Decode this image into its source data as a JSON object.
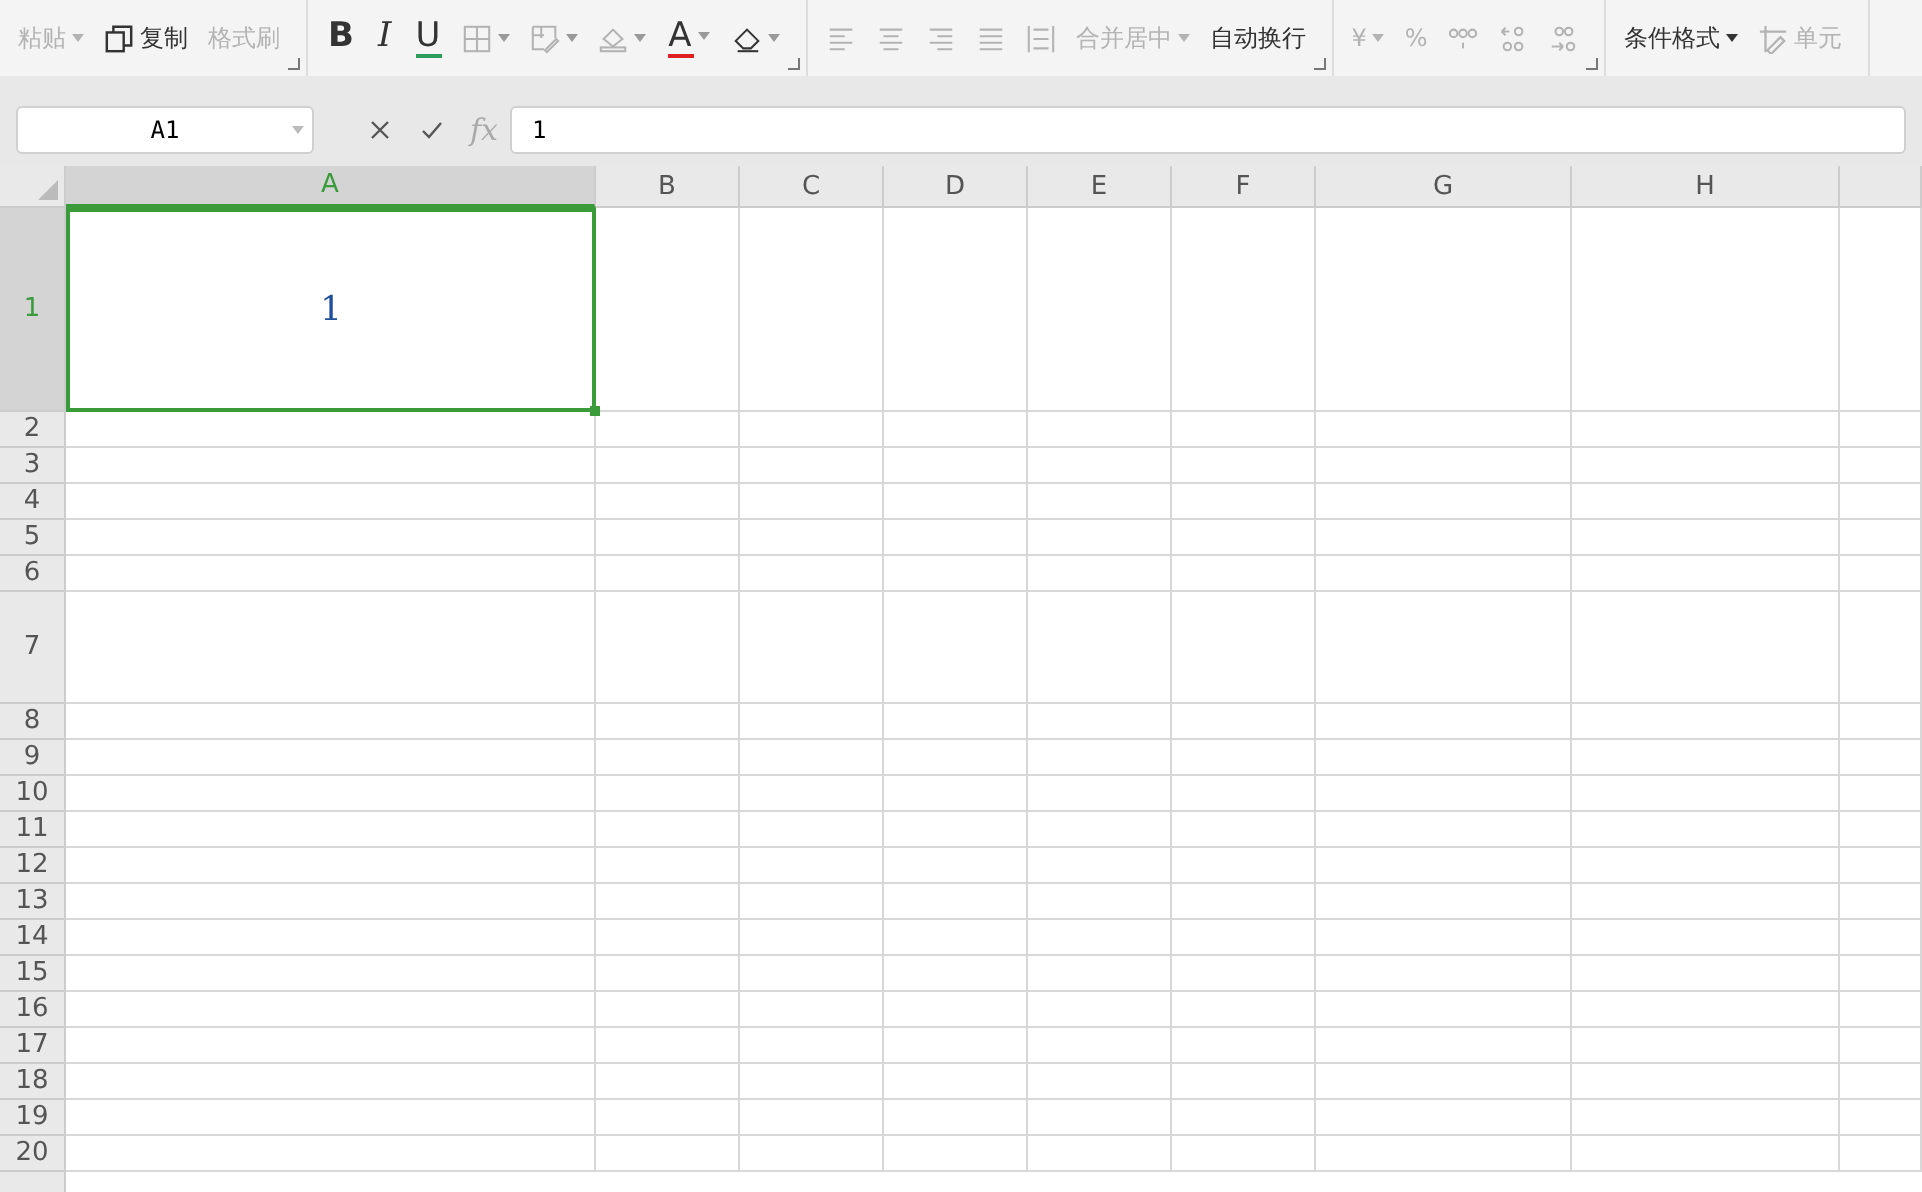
{
  "ribbon": [
    {
      "items": [
        {
          "kind": "text",
          "label": "粘贴",
          "disabled": true,
          "dropdown": true
        },
        {
          "kind": "copy",
          "label": "复制",
          "disabled": false
        },
        {
          "kind": "text",
          "label": "格式刷",
          "disabled": true
        }
      ],
      "launcher": true
    },
    {
      "items": [
        {
          "kind": "bold",
          "label": "B",
          "disabled": false
        },
        {
          "kind": "italic",
          "label": "I",
          "disabled": false
        },
        {
          "kind": "underline",
          "label": "U",
          "disabled": false
        },
        {
          "kind": "border",
          "disabled": true,
          "dropdown": true
        },
        {
          "kind": "cellstyle",
          "disabled": true,
          "dropdown": true
        },
        {
          "kind": "fill",
          "disabled": true,
          "dropdown": true
        },
        {
          "kind": "fontcolor",
          "label": "A",
          "color": "#e02020",
          "disabled": false,
          "dropdown": true
        },
        {
          "kind": "eraser",
          "disabled": false,
          "dropdown": true
        }
      ],
      "launcher": true
    },
    {
      "items": [
        {
          "kind": "alignleft",
          "disabled": true
        },
        {
          "kind": "aligncenter",
          "disabled": true
        },
        {
          "kind": "alignright",
          "disabled": true
        },
        {
          "kind": "justify",
          "disabled": true
        },
        {
          "kind": "distribute",
          "disabled": true
        },
        {
          "kind": "text",
          "label": "合并居中",
          "disabled": true,
          "dropdown": true
        },
        {
          "kind": "text",
          "label": "自动换行",
          "disabled": false
        }
      ],
      "launcher": true
    },
    {
      "items": [
        {
          "kind": "text",
          "label": "¥",
          "disabled": true,
          "dropdown": true
        },
        {
          "kind": "text",
          "label": "%",
          "disabled": true
        },
        {
          "kind": "thousands",
          "disabled": true
        },
        {
          "kind": "decinc",
          "disabled": true
        },
        {
          "kind": "decdec",
          "disabled": true
        }
      ],
      "launcher": true
    },
    {
      "items": [
        {
          "kind": "text",
          "label": "条件格式",
          "disabled": false,
          "dropdown": true
        },
        {
          "kind": "cellformat",
          "label": "单元",
          "disabled": true
        }
      ]
    }
  ],
  "name_box": {
    "value": "A1"
  },
  "formula_bar": {
    "fx": "fx",
    "value": "1"
  },
  "columns": [
    {
      "label": "A",
      "selected": true
    },
    {
      "label": "B",
      "selected": false
    },
    {
      "label": "C",
      "selected": false
    },
    {
      "label": "D",
      "selected": false
    },
    {
      "label": "E",
      "selected": false
    },
    {
      "label": "F",
      "selected": false
    },
    {
      "label": "G",
      "selected": false
    },
    {
      "label": "H",
      "selected": false
    }
  ],
  "rows": [
    {
      "label": "1",
      "selected": true,
      "cells": [
        {
          "value": "1",
          "selected": true
        }
      ]
    },
    {
      "label": "2",
      "selected": false
    },
    {
      "label": "3",
      "selected": false
    },
    {
      "label": "4",
      "selected": false
    },
    {
      "label": "5",
      "selected": false
    },
    {
      "label": "6",
      "selected": false
    },
    {
      "label": "7",
      "selected": false
    },
    {
      "label": "8",
      "selected": false
    },
    {
      "label": "9",
      "selected": false
    },
    {
      "label": "10",
      "selected": false
    },
    {
      "label": "11",
      "selected": false
    },
    {
      "label": "12",
      "selected": false
    },
    {
      "label": "13",
      "selected": false
    },
    {
      "label": "14",
      "selected": false
    },
    {
      "label": "15",
      "selected": false
    },
    {
      "label": "16",
      "selected": false
    },
    {
      "label": "17",
      "selected": false
    },
    {
      "label": "18",
      "selected": false
    },
    {
      "label": "19",
      "selected": false
    },
    {
      "label": "20",
      "selected": false
    }
  ]
}
